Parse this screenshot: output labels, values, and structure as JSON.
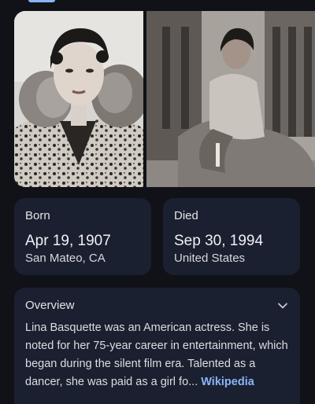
{
  "born": {
    "label": "Born",
    "date": "Apr 19, 1907",
    "place": "San Mateo, CA"
  },
  "died": {
    "label": "Died",
    "date": "Sep 30, 1994",
    "place": "United States"
  },
  "overview": {
    "title": "Overview",
    "text": "Lina Basquette was an American actress. She is noted for her 75-year career in entertainment, which began during the silent film era. Talented as a dancer, she was paid as a girl fo...",
    "source": "Wikipedia"
  },
  "colors": {
    "background": "#101218",
    "card": "#1b2030",
    "accent": "#8ab4f8"
  }
}
